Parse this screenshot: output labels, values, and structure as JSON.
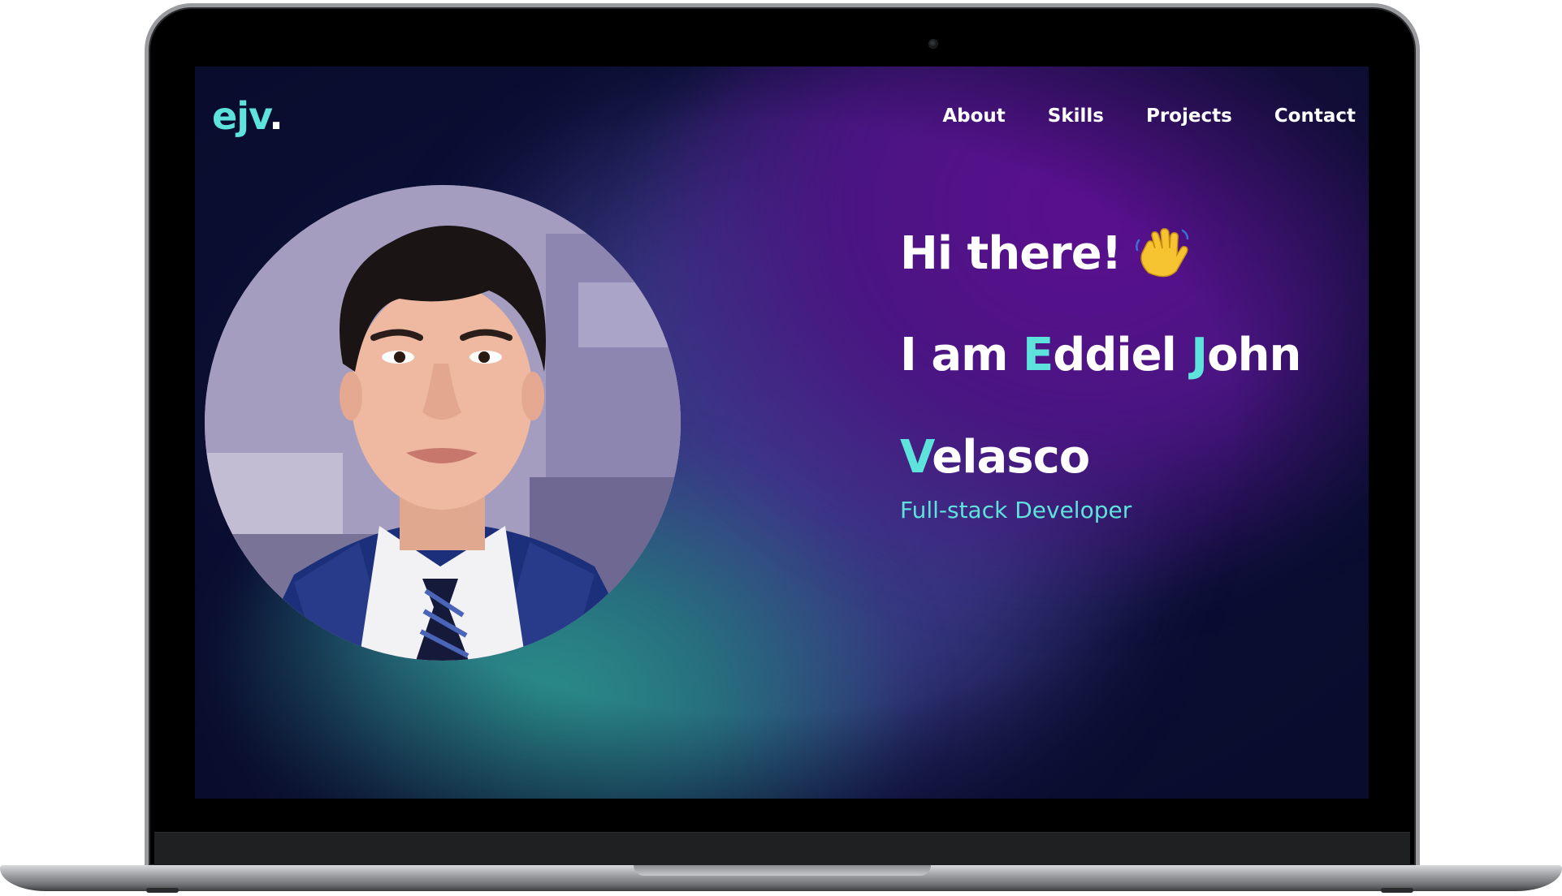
{
  "site": {
    "logo_text": "ejv",
    "logo_dot": "."
  },
  "nav": {
    "items": [
      {
        "label": "About"
      },
      {
        "label": "Skills"
      },
      {
        "label": "Projects"
      },
      {
        "label": "Contact"
      }
    ]
  },
  "hero": {
    "greeting": "Hi there!",
    "greeting_emoji": "waving-hand-icon",
    "intro": "I am ",
    "first_initial": "E",
    "first_rest": "ddiel ",
    "middle_initial": "J",
    "middle_rest": "ohn",
    "last_initial": "V",
    "last_rest": "elasco",
    "role": "Full-stack Developer"
  },
  "colors": {
    "accent": "#5ee3dc",
    "background": "#0a0e33",
    "purple_glow": "#5b0f8f",
    "teal_glow": "#2a8f8a",
    "text": "#ffffff"
  },
  "profile_photo": "portrait-photo"
}
